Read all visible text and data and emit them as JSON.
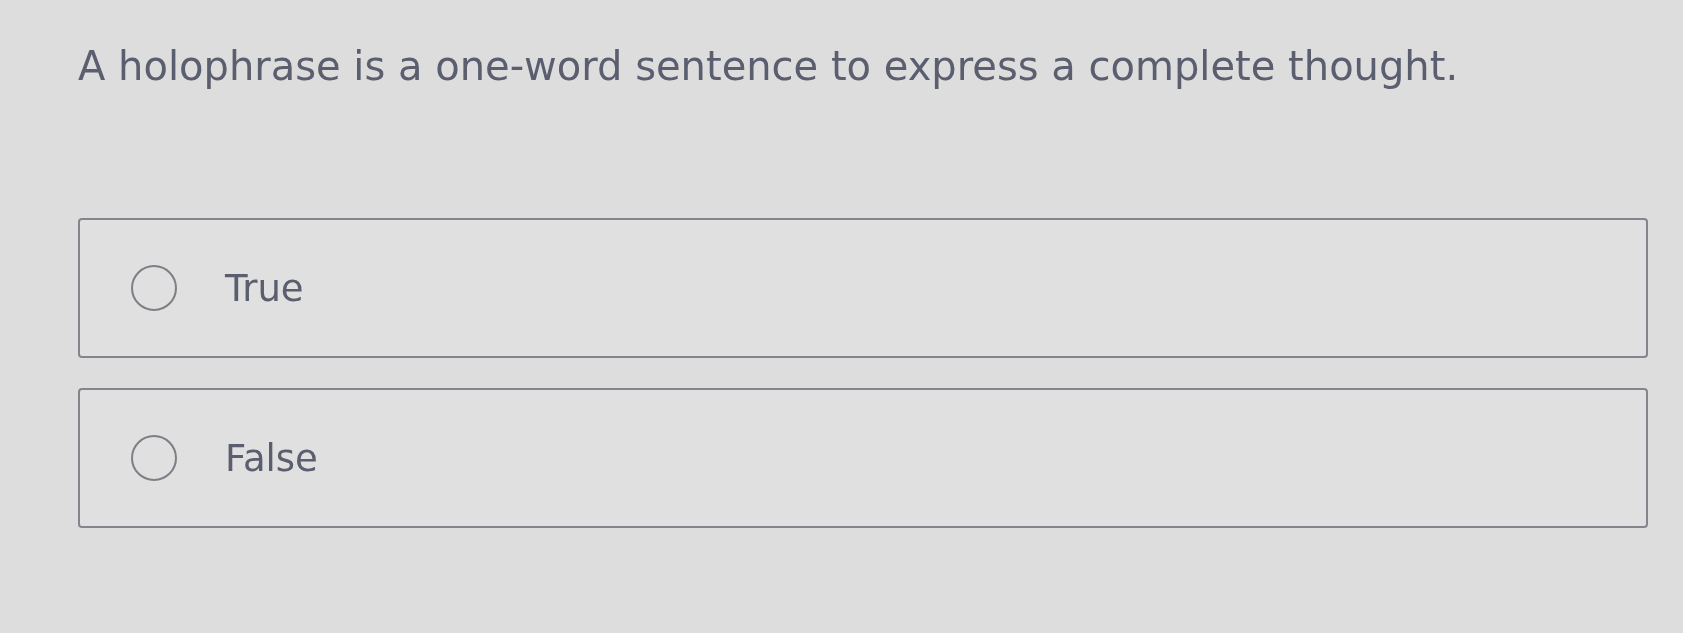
{
  "question": {
    "text": "A holophrase is a one-word sentence to express a complete thought."
  },
  "options": [
    {
      "label": "True",
      "selected": false
    },
    {
      "label": "False",
      "selected": false
    }
  ]
}
